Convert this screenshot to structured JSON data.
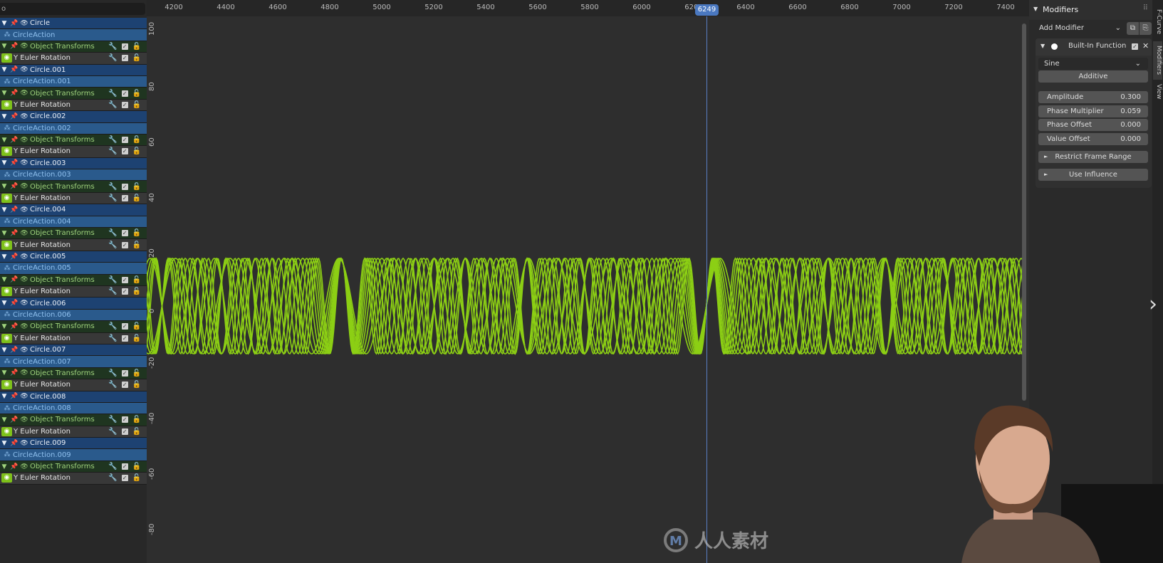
{
  "channels": [
    {
      "object": "Circle",
      "action": "CircleAction",
      "group": "Object Transforms",
      "fcurve": "Y Euler Rotation"
    },
    {
      "object": "Circle.001",
      "action": "CircleAction.001",
      "group": "Object Transforms",
      "fcurve": "Y Euler Rotation"
    },
    {
      "object": "Circle.002",
      "action": "CircleAction.002",
      "group": "Object Transforms",
      "fcurve": "Y Euler Rotation"
    },
    {
      "object": "Circle.003",
      "action": "CircleAction.003",
      "group": "Object Transforms",
      "fcurve": "Y Euler Rotation"
    },
    {
      "object": "Circle.004",
      "action": "CircleAction.004",
      "group": "Object Transforms",
      "fcurve": "Y Euler Rotation"
    },
    {
      "object": "Circle.005",
      "action": "CircleAction.005",
      "group": "Object Transforms",
      "fcurve": "Y Euler Rotation"
    },
    {
      "object": "Circle.006",
      "action": "CircleAction.006",
      "group": "Object Transforms",
      "fcurve": "Y Euler Rotation"
    },
    {
      "object": "Circle.007",
      "action": "CircleAction.007",
      "group": "Object Transforms",
      "fcurve": "Y Euler Rotation"
    },
    {
      "object": "Circle.008",
      "action": "CircleAction.008",
      "group": "Object Transforms",
      "fcurve": "Y Euler Rotation"
    },
    {
      "object": "Circle.009",
      "action": "CircleAction.009",
      "group": "Object Transforms",
      "fcurve": "Y Euler Rotation"
    }
  ],
  "search": {
    "value": "o"
  },
  "graph": {
    "x_ticks": [
      "4200",
      "4400",
      "4600",
      "4800",
      "5000",
      "5200",
      "5400",
      "5600",
      "5800",
      "6000",
      "6200",
      "6400",
      "6600",
      "6800",
      "7000",
      "7200",
      "7400"
    ],
    "y_ticks": [
      "100",
      "80",
      "60",
      "40",
      "20",
      "0",
      "-20",
      "-40",
      "-60",
      "-80"
    ],
    "current_frame": "6249",
    "curve_color": "#8ccf14"
  },
  "modifiers": {
    "header": "Modifiers",
    "add_modifier": "Add Modifier",
    "modifier_name": "Built-In Function",
    "function": "Sine",
    "mode": "Additive",
    "fields": [
      {
        "label": "Amplitude",
        "value": "0.300"
      },
      {
        "label": "Phase Multiplier",
        "value": "0.059"
      },
      {
        "label": "Phase Offset",
        "value": "0.000"
      },
      {
        "label": "Value Offset",
        "value": "0.000"
      }
    ],
    "restrict": "Restrict Frame Range",
    "influence": "Use Influence"
  },
  "tabs": [
    "F-Curve",
    "Modifiers",
    "View"
  ],
  "watermark": "人人素材"
}
